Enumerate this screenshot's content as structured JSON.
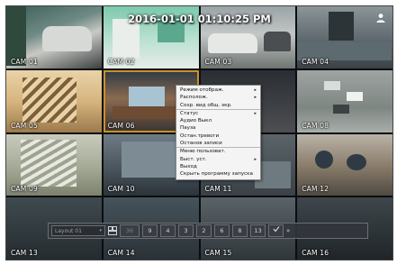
{
  "overlay": {
    "timestamp": "2016-01-01 01:10:25 PM",
    "user_icon": "user-icon"
  },
  "cameras": [
    {
      "label": "CAM 01"
    },
    {
      "label": "CAM 02"
    },
    {
      "label": "CAM 03"
    },
    {
      "label": "CAM 04"
    },
    {
      "label": "CAM 05"
    },
    {
      "label": "CAM 06"
    },
    {
      "label": ""
    },
    {
      "label": "CAM 08"
    },
    {
      "label": "CAM 09"
    },
    {
      "label": "CAM 10"
    },
    {
      "label": "CAM 11"
    },
    {
      "label": "CAM 12"
    },
    {
      "label": "CAM 13"
    },
    {
      "label": "CAM 14"
    },
    {
      "label": "CAM 15"
    },
    {
      "label": "CAM 16"
    }
  ],
  "context_menu": {
    "items": [
      {
        "label": "Режим отображ.",
        "submenu": true
      },
      {
        "label": "Располож.",
        "submenu": true
      },
      {
        "label": "Сохр. вид общ. экр.",
        "submenu": false
      },
      {
        "label": "Статус",
        "submenu": true
      },
      {
        "label": "Аудио Выкл",
        "submenu": false
      },
      {
        "label": "Пауза",
        "submenu": false
      },
      {
        "label": "Остан.тревоги",
        "submenu": false
      },
      {
        "label": "Останов записи",
        "submenu": false
      },
      {
        "label": "Меню пользоват.",
        "submenu": false
      },
      {
        "label": "Быст. уст.",
        "submenu": true
      },
      {
        "label": "Выход",
        "submenu": false
      },
      {
        "label": "Скрыть программу запуска",
        "submenu": false
      }
    ],
    "arrow_glyph": "▸"
  },
  "control_bar": {
    "layout_select_value": "Layout 01",
    "caret": "▾",
    "buttons": [
      "36",
      "9",
      "4",
      "3",
      "2",
      "6",
      "8",
      "13"
    ],
    "next_arrow": "»"
  },
  "colors": {
    "selected_border": "#c8922a",
    "menu_bg": "#f4f4f4",
    "bar_bg": "#32363c"
  }
}
